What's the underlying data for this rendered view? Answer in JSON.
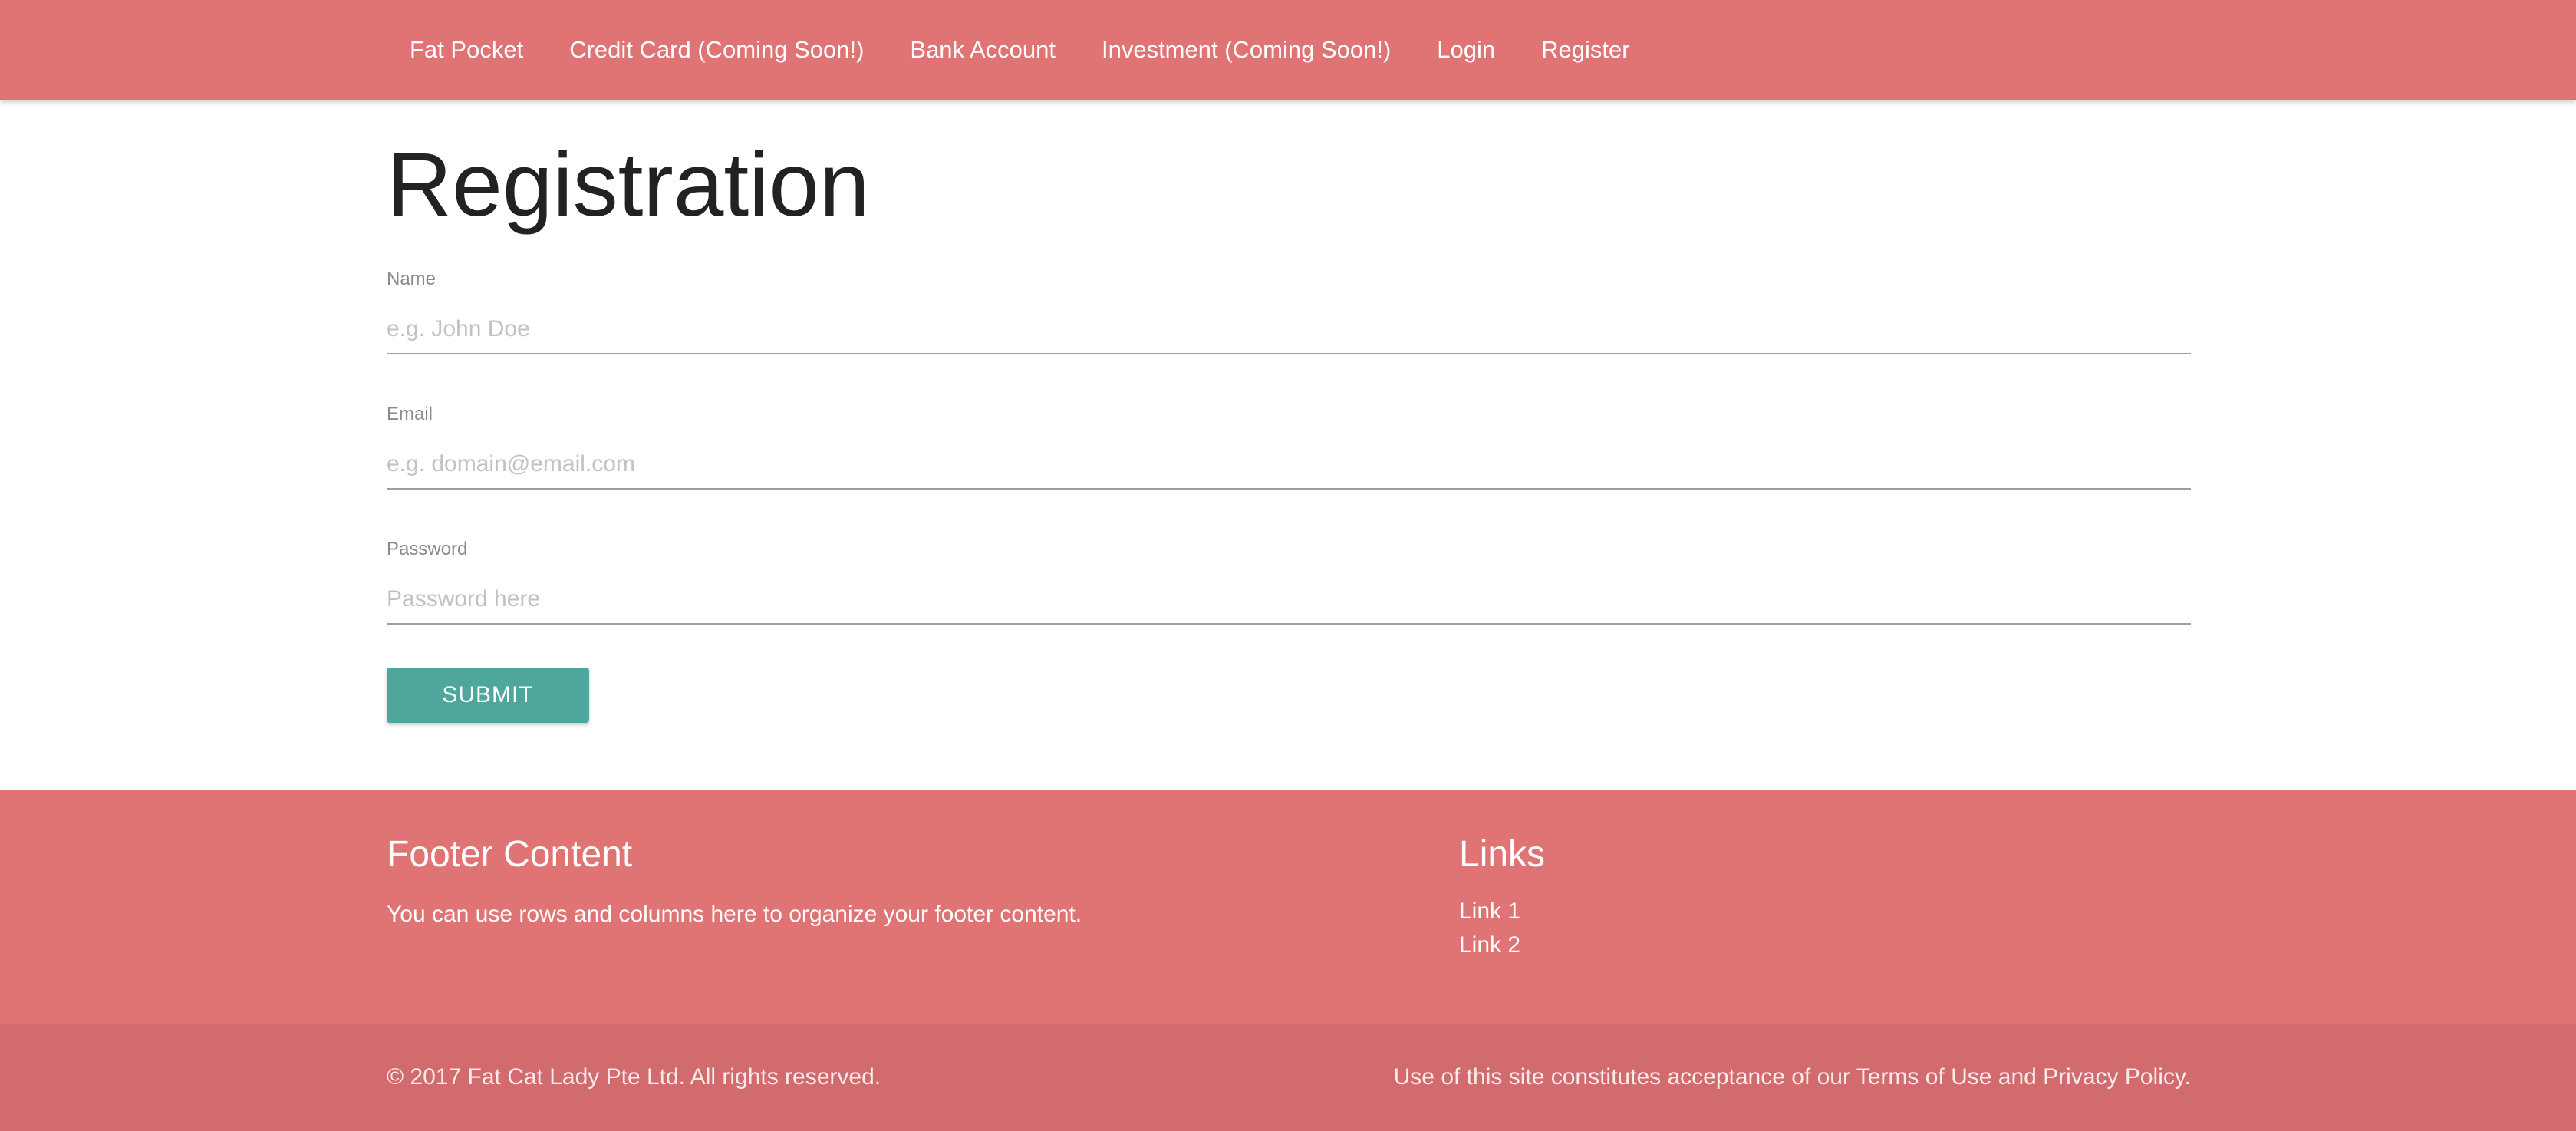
{
  "nav": {
    "brand": "Fat Pocket",
    "items": [
      {
        "label": "Credit Card (Coming Soon!)"
      },
      {
        "label": "Bank Account"
      },
      {
        "label": "Investment (Coming Soon!)"
      },
      {
        "label": "Login"
      },
      {
        "label": "Register"
      }
    ]
  },
  "page": {
    "title": "Registration"
  },
  "form": {
    "name": {
      "label": "Name",
      "placeholder": "e.g. John Doe",
      "value": ""
    },
    "email": {
      "label": "Email",
      "placeholder": "e.g. domain@email.com",
      "value": ""
    },
    "password": {
      "label": "Password",
      "placeholder": "Password here",
      "value": ""
    },
    "submit_label": "SUBMIT"
  },
  "footer": {
    "left_heading": "Footer Content",
    "left_text": "You can use rows and columns here to organize your footer content.",
    "right_heading": "Links",
    "links": [
      {
        "label": "Link 1"
      },
      {
        "label": "Link 2"
      }
    ],
    "copyright": "© 2017 Fat Cat Lady Pte Ltd. All rights reserved.",
    "terms": "Use of this site constitutes acceptance of our Terms of Use and Privacy Policy."
  },
  "colors": {
    "nav_bg": "#e07474",
    "footer_bg": "#e07474",
    "footer_bottom_bg": "#d16b6e",
    "button_bg": "#4ea69c",
    "title_text": "#222222"
  }
}
